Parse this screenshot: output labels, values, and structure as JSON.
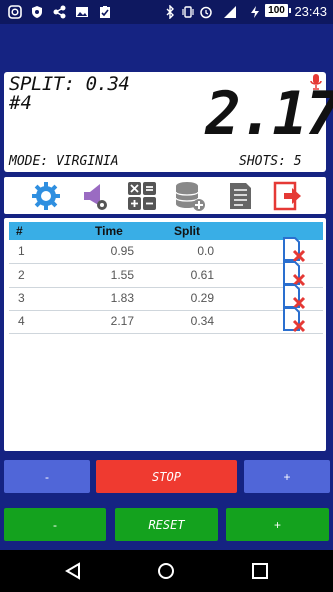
{
  "status_bar": {
    "time": "23:43",
    "battery": "100",
    "icons": [
      "instagram-icon",
      "shield-icon",
      "share-icon",
      "gallery-icon",
      "clipboard-icon",
      "bluetooth-icon",
      "vibrate-icon",
      "alarm-icon",
      "signal-icon",
      "charging-icon"
    ]
  },
  "timer": {
    "split_label": "SPLIT: 0.34",
    "shot_number": "#4",
    "main_time": "2.17",
    "mode_label": "MODE: VIRGINIA",
    "shots_label": "SHOTS: 5",
    "mic_icon": "microphone-icon"
  },
  "toolbar": {
    "items": [
      "settings-icon",
      "sound-settings-icon",
      "calculator-icon",
      "add-database-icon",
      "notes-icon",
      "exit-icon"
    ]
  },
  "table": {
    "headers": [
      "#",
      "Time",
      "Split"
    ],
    "rows": [
      {
        "num": "1",
        "time": "0.95",
        "split": "0.0"
      },
      {
        "num": "2",
        "time": "1.55",
        "split": "0.61"
      },
      {
        "num": "3",
        "time": "1.83",
        "split": "0.29"
      },
      {
        "num": "4",
        "time": "2.17",
        "split": "0.34"
      }
    ]
  },
  "controls": {
    "minus_top": "-",
    "stop": "STOP",
    "plus_top": "+",
    "minus_bottom": "-",
    "reset": "RESET",
    "plus_bottom": "+"
  },
  "colors": {
    "background": "#152382",
    "header_blue": "#39aee6",
    "stop_red": "#ef3a30",
    "green": "#14a21e",
    "button_blue": "#5066d8"
  }
}
